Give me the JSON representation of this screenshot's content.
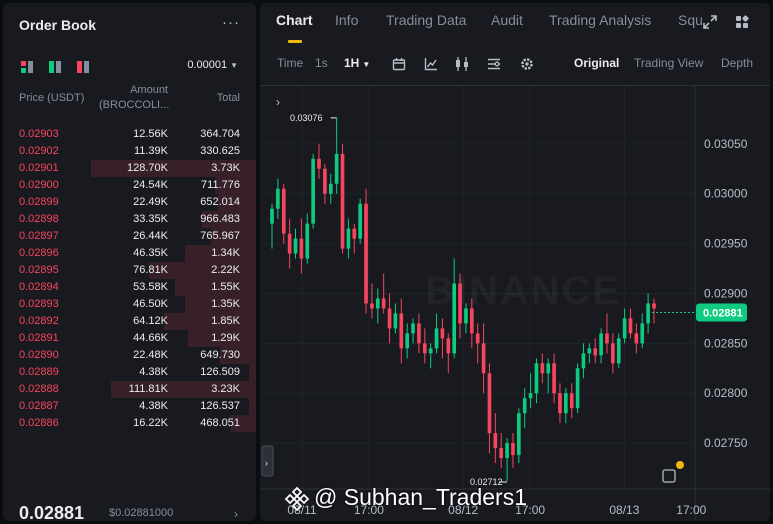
{
  "colors": {
    "bg": "#0b0e11",
    "panel": "#181a20",
    "up": "#0ecb81",
    "down": "#f6465d",
    "accent": "#f0b90b",
    "muted": "#848e9c"
  },
  "order_book": {
    "title": "Order Book",
    "more_icon": "more-dots-icon",
    "view_icons": [
      "both-sides-view-icon",
      "bids-view-icon",
      "asks-view-icon"
    ],
    "tick_size": "0.00001",
    "headers": {
      "price": "Price (USDT)",
      "amount_line1": "Amount",
      "amount_line2": "(BROCCOLI...",
      "total": "Total"
    },
    "asks": [
      {
        "price": "0.02903",
        "amount": "12.56K",
        "total": "364.704",
        "depth": 0
      },
      {
        "price": "0.02902",
        "amount": "11.39K",
        "total": "330.625",
        "depth": 0
      },
      {
        "price": "0.02901",
        "amount": "128.70K",
        "total": "3.73K",
        "depth": 1.0
      },
      {
        "price": "0.02900",
        "amount": "24.54K",
        "total": "711.776",
        "depth": 0.25
      },
      {
        "price": "0.02899",
        "amount": "22.49K",
        "total": "652.014",
        "depth": 0.23
      },
      {
        "price": "0.02898",
        "amount": "33.35K",
        "total": "966.483",
        "depth": 0.33
      },
      {
        "price": "0.02897",
        "amount": "26.44K",
        "total": "765.967",
        "depth": 0.27
      },
      {
        "price": "0.02896",
        "amount": "46.35K",
        "total": "1.34K",
        "depth": 0.43
      },
      {
        "price": "0.02895",
        "amount": "76.81K",
        "total": "2.22K",
        "depth": 0.65
      },
      {
        "price": "0.02894",
        "amount": "53.58K",
        "total": "1.55K",
        "depth": 0.49
      },
      {
        "price": "0.02893",
        "amount": "46.50K",
        "total": "1.35K",
        "depth": 0.43
      },
      {
        "price": "0.02892",
        "amount": "64.12K",
        "total": "1.85K",
        "depth": 0.56
      },
      {
        "price": "0.02891",
        "amount": "44.66K",
        "total": "1.29K",
        "depth": 0.41
      },
      {
        "price": "0.02890",
        "amount": "22.48K",
        "total": "649.730",
        "depth": 0.22
      },
      {
        "price": "0.02889",
        "amount": "4.38K",
        "total": "126.509",
        "depth": 0.04
      },
      {
        "price": "0.02888",
        "amount": "111.81K",
        "total": "3.23K",
        "depth": 0.88
      },
      {
        "price": "0.02887",
        "amount": "4.38K",
        "total": "126.537",
        "depth": 0.04
      },
      {
        "price": "0.02886",
        "amount": "16.22K",
        "total": "468.051",
        "depth": 0.15
      }
    ],
    "last_price": "0.02881",
    "last_price_usd": "$0.02881000",
    "chevron": "›"
  },
  "chart_panel": {
    "tabs": [
      {
        "label": "Chart",
        "active": true
      },
      {
        "label": "Info"
      },
      {
        "label": "Trading Data"
      },
      {
        "label": "Audit"
      },
      {
        "label": "Trading Analysis"
      },
      {
        "label": "Squ"
      }
    ],
    "tab_icons": [
      "expand-icon",
      "grid-layout-icon"
    ],
    "toolbar": {
      "time_label": "Time",
      "intervals": [
        "1s",
        "1H"
      ],
      "selected_interval": "1H",
      "tool_icons": [
        "calendar-icon",
        "indicator-icon",
        "candle-type-icon",
        "layout-icon",
        "settings-icon"
      ],
      "views": [
        "Original",
        "Trading View",
        "Depth"
      ],
      "selected_view": "Original"
    },
    "expand_toggle": "›",
    "collapse_toggle": "›",
    "watermark": "BINANCE",
    "overlay_label": "@ Subhan_Traders1",
    "chart_data": {
      "type": "candlestick",
      "title": "",
      "y_ticks": [
        "0.03050",
        "0.03000",
        "0.02950",
        "0.02900",
        "0.02850",
        "0.02800",
        "0.02750"
      ],
      "ylim": [
        0.02704,
        0.03108
      ],
      "x_ticks": [
        "08/11",
        "17:00",
        "08/12",
        "17:00",
        "08/13",
        "17:00"
      ],
      "x_tick_positions": [
        -20,
        -11.7,
        0,
        8.3,
        20,
        28.3
      ],
      "x_tick_unit": "hours relative to 08/12 00:00",
      "high_label": "0.03076",
      "low_label": "0.02712",
      "last_price": "0.02881",
      "candles": [
        {
          "o": 0.0297,
          "h": 0.0299,
          "l": 0.02945,
          "c": 0.02985
        },
        {
          "o": 0.02985,
          "h": 0.03015,
          "l": 0.02975,
          "c": 0.03005
        },
        {
          "o": 0.03005,
          "h": 0.0301,
          "l": 0.0295,
          "c": 0.0296
        },
        {
          "o": 0.0296,
          "h": 0.02975,
          "l": 0.02925,
          "c": 0.0294
        },
        {
          "o": 0.0294,
          "h": 0.02965,
          "l": 0.02935,
          "c": 0.02955
        },
        {
          "o": 0.02955,
          "h": 0.02975,
          "l": 0.0292,
          "c": 0.02935
        },
        {
          "o": 0.02935,
          "h": 0.0298,
          "l": 0.0293,
          "c": 0.0297
        },
        {
          "o": 0.0297,
          "h": 0.0304,
          "l": 0.02965,
          "c": 0.03035
        },
        {
          "o": 0.03035,
          "h": 0.0305,
          "l": 0.03015,
          "c": 0.03025
        },
        {
          "o": 0.03025,
          "h": 0.0303,
          "l": 0.0299,
          "c": 0.03
        },
        {
          "o": 0.03,
          "h": 0.0302,
          "l": 0.0299,
          "c": 0.0301
        },
        {
          "o": 0.0301,
          "h": 0.03076,
          "l": 0.03,
          "c": 0.0304
        },
        {
          "o": 0.0304,
          "h": 0.0305,
          "l": 0.0294,
          "c": 0.02945
        },
        {
          "o": 0.02945,
          "h": 0.02975,
          "l": 0.02935,
          "c": 0.02965
        },
        {
          "o": 0.02965,
          "h": 0.0297,
          "l": 0.0294,
          "c": 0.02955
        },
        {
          "o": 0.02955,
          "h": 0.02995,
          "l": 0.0295,
          "c": 0.0299
        },
        {
          "o": 0.0299,
          "h": 0.03005,
          "l": 0.0288,
          "c": 0.0289
        },
        {
          "o": 0.0289,
          "h": 0.0291,
          "l": 0.02875,
          "c": 0.02885
        },
        {
          "o": 0.02885,
          "h": 0.02905,
          "l": 0.0287,
          "c": 0.02895
        },
        {
          "o": 0.02895,
          "h": 0.0292,
          "l": 0.0288,
          "c": 0.02885
        },
        {
          "o": 0.02885,
          "h": 0.029,
          "l": 0.0285,
          "c": 0.02865
        },
        {
          "o": 0.02865,
          "h": 0.0289,
          "l": 0.0286,
          "c": 0.0288
        },
        {
          "o": 0.0288,
          "h": 0.02895,
          "l": 0.0283,
          "c": 0.02845
        },
        {
          "o": 0.02845,
          "h": 0.0287,
          "l": 0.02835,
          "c": 0.0286
        },
        {
          "o": 0.0286,
          "h": 0.02875,
          "l": 0.0285,
          "c": 0.0287
        },
        {
          "o": 0.0287,
          "h": 0.0288,
          "l": 0.0284,
          "c": 0.0285
        },
        {
          "o": 0.0285,
          "h": 0.02865,
          "l": 0.0283,
          "c": 0.0284
        },
        {
          "o": 0.0284,
          "h": 0.0285,
          "l": 0.02825,
          "c": 0.02845
        },
        {
          "o": 0.02845,
          "h": 0.0288,
          "l": 0.0284,
          "c": 0.02865
        },
        {
          "o": 0.02865,
          "h": 0.02875,
          "l": 0.02835,
          "c": 0.02855
        },
        {
          "o": 0.02855,
          "h": 0.0286,
          "l": 0.0282,
          "c": 0.0284
        },
        {
          "o": 0.0284,
          "h": 0.02935,
          "l": 0.02835,
          "c": 0.0291
        },
        {
          "o": 0.0291,
          "h": 0.0292,
          "l": 0.02855,
          "c": 0.0287
        },
        {
          "o": 0.0287,
          "h": 0.0289,
          "l": 0.0286,
          "c": 0.02885
        },
        {
          "o": 0.02885,
          "h": 0.02895,
          "l": 0.02845,
          "c": 0.0286
        },
        {
          "o": 0.0286,
          "h": 0.0287,
          "l": 0.0283,
          "c": 0.0285
        },
        {
          "o": 0.0285,
          "h": 0.0287,
          "l": 0.028,
          "c": 0.0282
        },
        {
          "o": 0.0282,
          "h": 0.0283,
          "l": 0.0274,
          "c": 0.0276
        },
        {
          "o": 0.0276,
          "h": 0.0278,
          "l": 0.0273,
          "c": 0.02745
        },
        {
          "o": 0.02745,
          "h": 0.0276,
          "l": 0.02725,
          "c": 0.02735
        },
        {
          "o": 0.02735,
          "h": 0.02755,
          "l": 0.02712,
          "c": 0.0275
        },
        {
          "o": 0.0275,
          "h": 0.0276,
          "l": 0.02725,
          "c": 0.02738
        },
        {
          "o": 0.02738,
          "h": 0.02785,
          "l": 0.0273,
          "c": 0.0278
        },
        {
          "o": 0.0278,
          "h": 0.02805,
          "l": 0.02765,
          "c": 0.02795
        },
        {
          "o": 0.02795,
          "h": 0.0282,
          "l": 0.02785,
          "c": 0.028
        },
        {
          "o": 0.028,
          "h": 0.02835,
          "l": 0.0279,
          "c": 0.0283
        },
        {
          "o": 0.0283,
          "h": 0.0284,
          "l": 0.0281,
          "c": 0.0282
        },
        {
          "o": 0.0282,
          "h": 0.02835,
          "l": 0.028,
          "c": 0.0283
        },
        {
          "o": 0.0283,
          "h": 0.0284,
          "l": 0.0279,
          "c": 0.028
        },
        {
          "o": 0.028,
          "h": 0.0281,
          "l": 0.0277,
          "c": 0.0278
        },
        {
          "o": 0.0278,
          "h": 0.02805,
          "l": 0.0277,
          "c": 0.028
        },
        {
          "o": 0.028,
          "h": 0.0281,
          "l": 0.02775,
          "c": 0.02785
        },
        {
          "o": 0.02785,
          "h": 0.0283,
          "l": 0.0278,
          "c": 0.02825
        },
        {
          "o": 0.02825,
          "h": 0.0285,
          "l": 0.02815,
          "c": 0.0284
        },
        {
          "o": 0.0284,
          "h": 0.0285,
          "l": 0.0283,
          "c": 0.02845
        },
        {
          "o": 0.02845,
          "h": 0.02855,
          "l": 0.0283,
          "c": 0.02838
        },
        {
          "o": 0.02838,
          "h": 0.02865,
          "l": 0.0283,
          "c": 0.0286
        },
        {
          "o": 0.0286,
          "h": 0.0288,
          "l": 0.0284,
          "c": 0.0285
        },
        {
          "o": 0.0285,
          "h": 0.0286,
          "l": 0.0282,
          "c": 0.0283
        },
        {
          "o": 0.0283,
          "h": 0.0286,
          "l": 0.02825,
          "c": 0.02855
        },
        {
          "o": 0.02855,
          "h": 0.02885,
          "l": 0.0285,
          "c": 0.02875
        },
        {
          "o": 0.02875,
          "h": 0.02885,
          "l": 0.02855,
          "c": 0.0286
        },
        {
          "o": 0.0286,
          "h": 0.0287,
          "l": 0.0284,
          "c": 0.0285
        },
        {
          "o": 0.0285,
          "h": 0.0288,
          "l": 0.02845,
          "c": 0.0287
        },
        {
          "o": 0.0287,
          "h": 0.029,
          "l": 0.0286,
          "c": 0.0289
        },
        {
          "o": 0.0289,
          "h": 0.02895,
          "l": 0.0287,
          "c": 0.02885
        }
      ]
    }
  }
}
